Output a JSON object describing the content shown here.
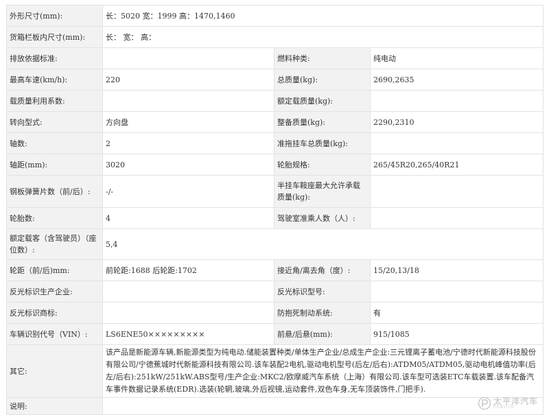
{
  "rows": [
    {
      "l1": "外形尺寸(mm):",
      "v1": "长：5020 宽：1999 高：1470,1460"
    },
    {
      "l1": "货箱栏板内尺寸(mm):",
      "v1": "长： 宽： 高："
    },
    {
      "l1": "排放依据标准:",
      "v1": "",
      "l2": "燃料种类:",
      "v2": "纯电动"
    },
    {
      "l1": "最高车速(km/h):",
      "v1": "220",
      "l2": "总质量(kg):",
      "v2": "2690,2635"
    },
    {
      "l1": "载质量利用系数:",
      "v1": "",
      "l2": "额定载质量(kg):",
      "v2": ""
    },
    {
      "l1": "转向型式:",
      "v1": "方向盘",
      "l2": "整备质量(kg):",
      "v2": "2290,2310"
    },
    {
      "l1": "轴数:",
      "v1": "2",
      "l2": "准拖挂车总质量(kg):",
      "v2": ""
    },
    {
      "l1": "轴距(mm):",
      "v1": "3020",
      "l2": "轮胎规格:",
      "v2": "265/45R20,265/40R21"
    },
    {
      "l1": "钢板弹簧片数（前/后）:",
      "v1": "-/-",
      "l2": "半挂车鞍座最大允许承载质量(kg):",
      "v2": ""
    },
    {
      "l1": "轮胎数:",
      "v1": "4",
      "l2": "驾驶室准乘人数（人）:",
      "v2": ""
    },
    {
      "l1": "额定载客（含驾驶员）（座位数）:",
      "v1": "5,4"
    },
    {
      "l1": "轮距（前/后)mm:",
      "v1": "前轮距:1688 后轮距:1702",
      "l2": "接近角/离去角（度）:",
      "v2": "15/20,13/18"
    },
    {
      "l1": "反光标识生产企业:",
      "v1": "",
      "l2": "反光标识型号:",
      "v2": ""
    },
    {
      "l1": "反光标识商标:",
      "v1": "",
      "l2": "防抱死制动系统:",
      "v2": "有"
    },
    {
      "l1": "车辆识别代号（VIN）:",
      "v1": "LS6ENE50×××××××××",
      "l2": "前悬/后悬(mm):",
      "v2": "915/1085"
    },
    {
      "l1": "其它:",
      "v1": "该产品是新能源车辆,新能源类型为纯电动.储能装置种类/单体生产企业/总成生产企业:三元锂离子蓄电池/宁德时代新能源科技股份有限公司/宁德蕉城时代新能源科技有限公司.该车装配2电机,驱动电机型号(后左/后右):ATDM05/ATDM05,驱动电机峰值功率(后左/后右):251kW/251kW.ABS型号/生产企业:MKC2/欧摩威汽车系统（上海）有限公司.该车型可选装ETC车载装置.该车配备汽车事件数据记录系统(EDR).选装(轮辋,玻璃,外后视镜,运动套件,双色车身,无车顶装饰件,门把手)."
    },
    {
      "l1": "说明:",
      "v1": ""
    }
  ],
  "watermark": {
    "main": "太平洋汽车",
    "sub": "PCAUTO"
  }
}
